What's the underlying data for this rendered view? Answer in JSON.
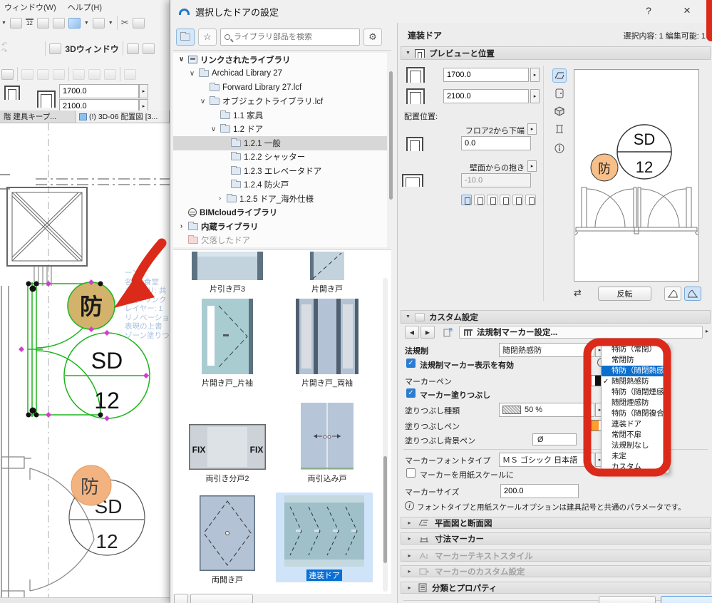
{
  "colors": {
    "accent_blue": "#2b7cd3",
    "highlight_blue": "#0c6ecd",
    "selection_green": "#1db51d",
    "handle_magenta": "#cf3fcf",
    "annotation_red": "#dc2a1a",
    "fire_badge_tan": "#d3b26c",
    "fire_badge_orange": "#f2b381",
    "pen_orange": "#f08200",
    "pen_black": "#111111"
  },
  "icons": {
    "caret_down": "▼",
    "spin_right": "▸",
    "caret_left": "◀",
    "caret_right": "▶",
    "tree_open": "∨",
    "tree_closed": "›",
    "check": "✓",
    "close": "×",
    "help": "?",
    "star": "☆",
    "gear": "⚙",
    "scissors": "✂",
    "undo": "↶",
    "redo": "↷",
    "empty_pen": "Ø",
    "info": "i",
    "mirror": "⇄",
    "dim": "12"
  },
  "app": {
    "menu": [
      "ウィンドウ(W)",
      "ヘルプ(H)"
    ],
    "toolbar": {
      "view3d": "3Dウィンドウ"
    },
    "size_fields": {
      "width": "1700.0",
      "height": "2100.0"
    },
    "tabs": [
      {
        "label": "階 建具キープ..."
      },
      {
        "label": "(!) 3D-06 配置図 [3..."
      }
    ],
    "plan": {
      "fire_badge": "防",
      "marker_line1": "SD",
      "marker_line2": "12",
      "zone_tooltip": [
        "ーン",
        "名前: 食堂",
        "カテゴリ: 共",
        "高さ: リンク",
        "レイヤー: 1",
        "リノベーション",
        "表現の上書",
        "ゾーン塗りつ"
      ]
    }
  },
  "dialog": {
    "title": "選択したドアの設定",
    "library": {
      "search_placeholder": "ライブラリ部品を検索",
      "tree": [
        {
          "label": "リンクされたライブラリ"
        },
        {
          "label": "Archicad Library 27"
        },
        {
          "label": "Forward Library 27.lcf"
        },
        {
          "label": "オブジェクトライブラリ.lcf"
        },
        {
          "label": "1.1 家具"
        },
        {
          "label": "1.2 ドア"
        },
        {
          "label": "1.2.1 一般"
        },
        {
          "label": "1.2.2 シャッター"
        },
        {
          "label": "1.2.3 エレベータドア"
        },
        {
          "label": "1.2.4 防火戸"
        },
        {
          "label": "1.2.5 ドア_海外仕様"
        },
        {
          "label": "BIMcloudライブラリ"
        },
        {
          "label": "内蔵ライブラリ"
        },
        {
          "label": "欠落したドア"
        }
      ],
      "thumbnails": [
        {
          "label": "片引き戸3"
        },
        {
          "label": "片開き戸"
        },
        {
          "label": "片開き戸_片袖"
        },
        {
          "label": "片開き戸_両袖"
        },
        {
          "label": "両引き分戸2"
        },
        {
          "label": "両引込み戸"
        },
        {
          "label": "両開き戸"
        },
        {
          "label": "連装ドア"
        }
      ],
      "fix_label": "FIX"
    },
    "settings": {
      "subject": "連装ドア",
      "selection_info": "選択内容: 1 編集可能: 1",
      "section_preview": "プレビューと位置",
      "section_custom": "カスタム設定",
      "width": "1700.0",
      "height": "2100.0",
      "position_label": "配置位置:",
      "floor_anchor": "フロア2から下端",
      "sill_value": "0.0",
      "reveal_label": "壁面からの抱き",
      "reveal_value": "-10.0",
      "flip_button": "反転",
      "marker_panel": "法規制マーカー設定...",
      "regulation_label": "法規制",
      "regulation_value": "随閉熱感防",
      "marker_visible_label": "法規制マーカー表示を有効",
      "marker_pen_label": "マーカーペン",
      "marker_fill_label": "マーカー塗りつぶし",
      "fill_type_label": "塗りつぶし種類",
      "fill_type_value": "50 %",
      "fill_pen_label": "塗りつぶしペン",
      "fill_bg_pen_label": "塗りつぶし背景ペン",
      "font_type_label": "マーカーフォントタイプ",
      "font_type_value": "ＭＳ ゴシック 日本語",
      "paper_scale_label": "マーカーを用紙スケールに",
      "marker_size_label": "マーカーサイズ",
      "marker_size_value": "200.0",
      "info_note": "フォントタイプと用紙スケールオプションは建具記号と共通のパラメータです。",
      "accordions": [
        {
          "label": "平面図と断面図"
        },
        {
          "label": "寸法マーカー"
        },
        {
          "label": "マーカーテキストスタイル"
        },
        {
          "label": "マーカーのカスタム設定"
        },
        {
          "label": "分類とプロパティ"
        }
      ],
      "preview": {
        "fire_badge": "防",
        "marker_line1": "SD",
        "marker_line2": "12"
      }
    }
  },
  "dropdown": {
    "items": [
      "特防（常閉）",
      "常閉防",
      "特防（随閉熱感）",
      "随閉熱感防",
      "特防（随閉煙感）",
      "随閉煙感防",
      "特防（随閉複合）",
      "連装ドア",
      "常閉不扉",
      "法規制なし",
      "未定",
      "カスタム"
    ]
  }
}
